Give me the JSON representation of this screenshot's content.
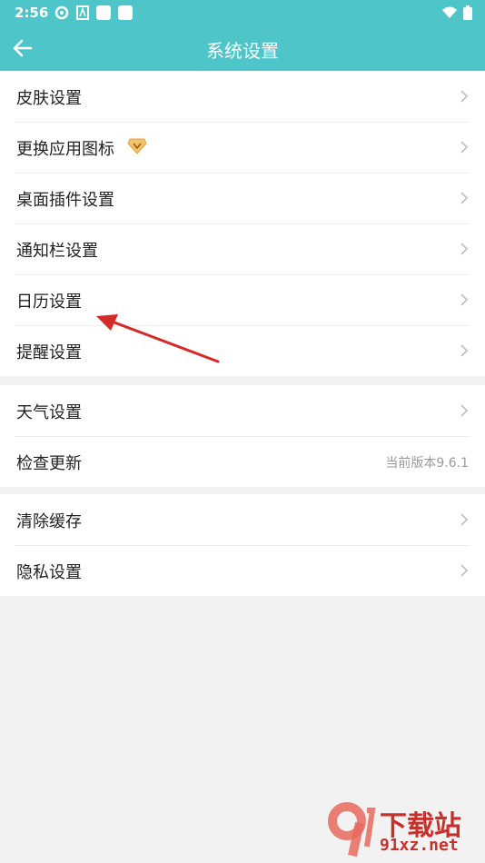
{
  "status": {
    "time": "2:56"
  },
  "header": {
    "title": "系统设置"
  },
  "groups": [
    {
      "items": [
        {
          "label": "皮肤设置"
        },
        {
          "label": "更换应用图标"
        },
        {
          "label": "桌面插件设置"
        },
        {
          "label": "通知栏设置"
        },
        {
          "label": "日历设置"
        },
        {
          "label": "提醒设置"
        }
      ]
    },
    {
      "items": [
        {
          "label": "天气设置"
        },
        {
          "label": "检查更新",
          "value": "当前版本9.6.1"
        }
      ]
    },
    {
      "items": [
        {
          "label": "清除缓存"
        },
        {
          "label": "隐私设置"
        }
      ]
    }
  ],
  "watermark": {
    "brand": "下载站",
    "url": "91xz.net",
    "logo_text": "9"
  },
  "colors": {
    "accent": "#4ec5c9",
    "arrow": "#d42a2a",
    "badge": "#e8a23c"
  },
  "icons": {
    "back": "arrow-left-icon",
    "chevron": "chevron-right-icon",
    "badge": "diamond-vip-icon"
  }
}
